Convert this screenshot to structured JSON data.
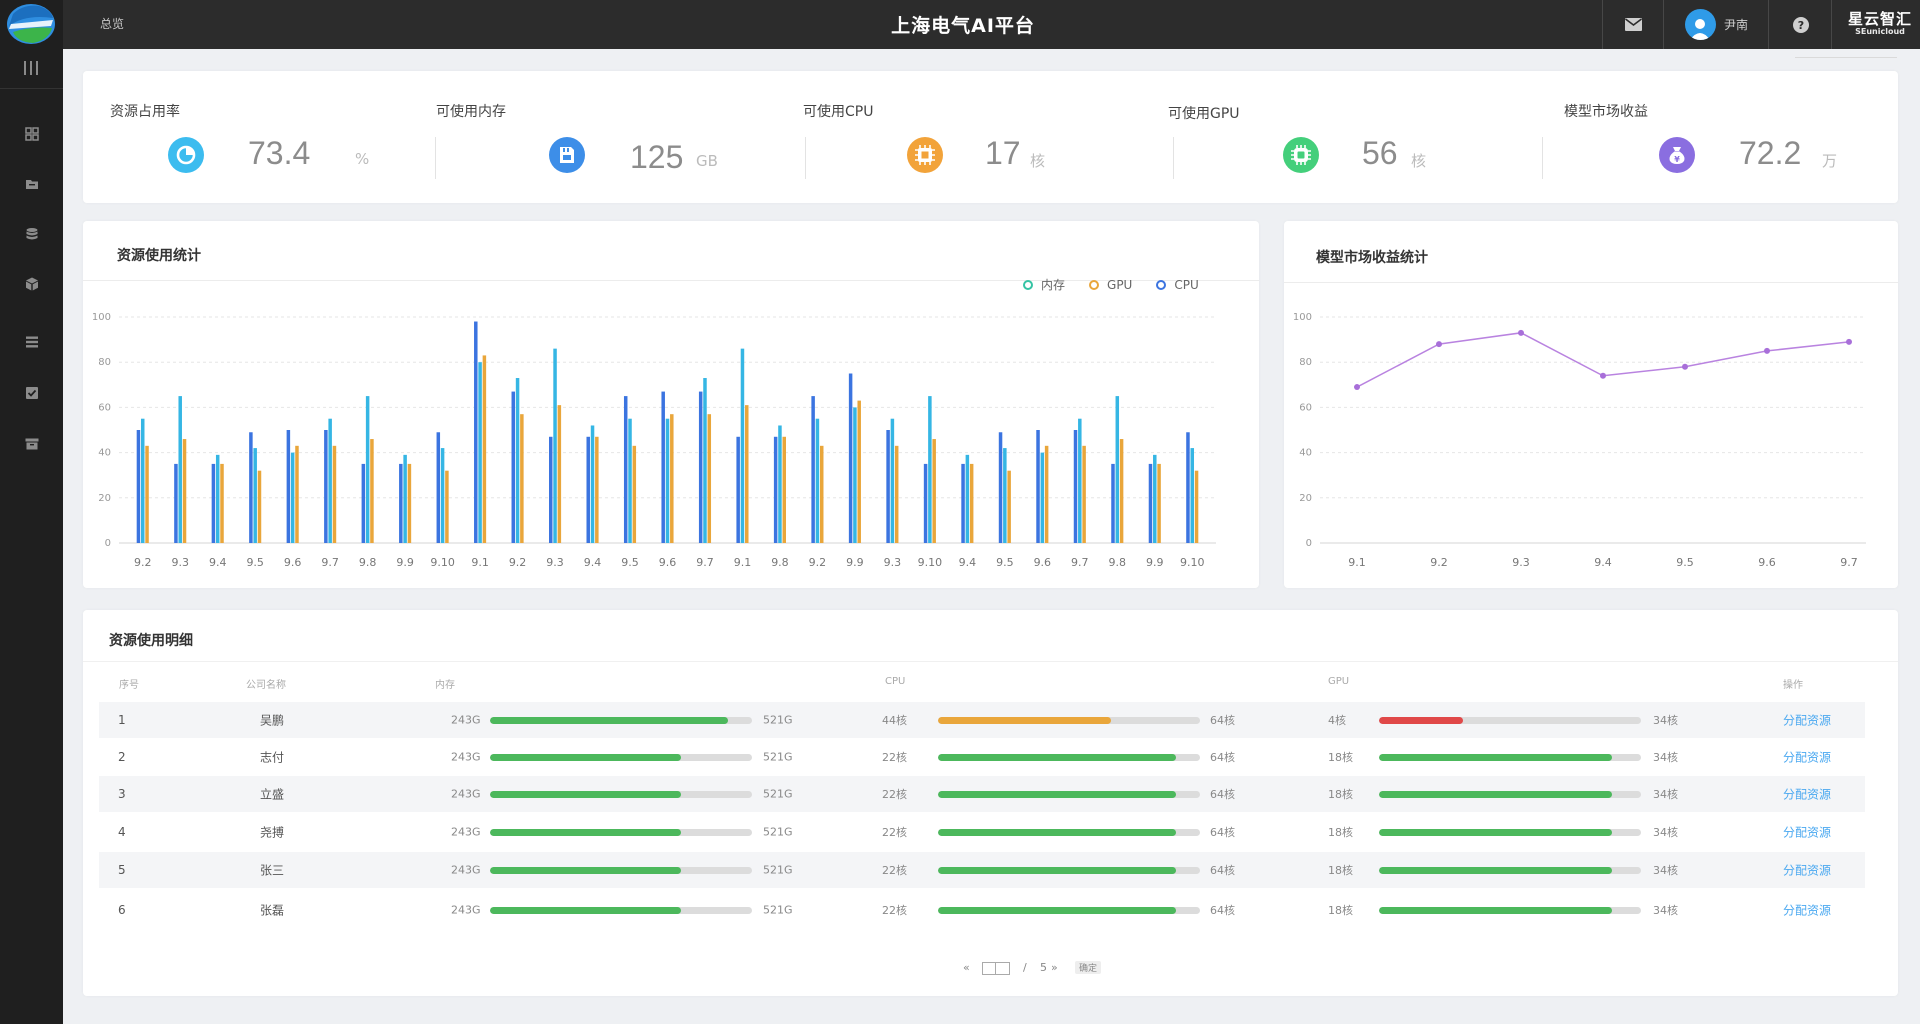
{
  "header": {
    "breadcrumb": "总览",
    "title": "上海电气AI平台",
    "user_name": "尹南",
    "brand_main": "星云智汇",
    "brand_sub": "SEunicloud"
  },
  "sidebar": {
    "items": [
      {
        "icon": "dashboard-icon"
      },
      {
        "icon": "folder-icon"
      },
      {
        "icon": "database-icon"
      },
      {
        "icon": "cube-icon"
      },
      {
        "icon": "list-icon"
      },
      {
        "icon": "checkbox-icon"
      },
      {
        "icon": "archive-icon"
      }
    ]
  },
  "stats": [
    {
      "label": "资源占用率",
      "value": "73.4",
      "unit": "%",
      "color": "#3cbcef",
      "icon": "gauge-icon"
    },
    {
      "label": "可使用内存",
      "value": "125",
      "unit": "GB",
      "color": "#3d8ee8",
      "icon": "memory-card-icon"
    },
    {
      "label": "可使用CPU",
      "value": "17",
      "unit": "核",
      "color": "#f2a33a",
      "icon": "cpu-chip-icon"
    },
    {
      "label": "可使用GPU",
      "value": "56",
      "unit": "核",
      "color": "#44cf7b",
      "icon": "gpu-chip-icon"
    },
    {
      "label": "模型市场收益",
      "value": "72.2",
      "unit": "万",
      "color": "#8a6ee0",
      "icon": "money-bag-icon"
    }
  ],
  "resource_chart": {
    "title": "资源使用统计",
    "legend": [
      {
        "name": "内存",
        "color": "#35c3a4"
      },
      {
        "name": "GPU",
        "color": "#e9a63b"
      },
      {
        "name": "CPU",
        "color": "#3b74e0"
      }
    ]
  },
  "revenue_chart": {
    "title": "模型市场收益统计"
  },
  "chart_data": [
    {
      "type": "bar",
      "title": "资源使用统计",
      "xlabel": "",
      "ylabel": "",
      "ylim": [
        0,
        100
      ],
      "yticks": [
        0,
        20,
        40,
        60,
        80,
        100
      ],
      "grid": true,
      "legend_position": "top-right",
      "categories": [
        "9.2",
        "9.3",
        "9.4",
        "9.5",
        "9.6",
        "9.7",
        "9.8",
        "9.9",
        "9.10",
        "9.1",
        "9.2",
        "9.3",
        "9.4",
        "9.5",
        "9.6",
        "9.7",
        "9.1",
        "9.8",
        "9.2",
        "9.9",
        "9.3",
        "9.10",
        "9.4",
        "9.5",
        "9.6",
        "9.7",
        "9.8",
        "9.9",
        "9.10"
      ],
      "series": [
        {
          "name": "CPU",
          "color": "#3b74e0",
          "values": [
            50,
            35,
            35,
            49,
            50,
            50,
            35,
            35,
            49,
            98,
            67,
            47,
            47,
            65,
            67,
            67,
            47,
            47,
            65,
            75,
            50,
            35,
            35,
            49,
            50,
            50,
            35,
            35,
            49
          ]
        },
        {
          "name": "内存",
          "color": "#35b6e4",
          "values": [
            55,
            65,
            39,
            42,
            40,
            55,
            65,
            39,
            42,
            80,
            73,
            86,
            52,
            55,
            55,
            73,
            86,
            52,
            55,
            60,
            55,
            65,
            39,
            42,
            40,
            55,
            65,
            39,
            42
          ]
        },
        {
          "name": "GPU",
          "color": "#e9a63b",
          "values": [
            43,
            46,
            35,
            32,
            43,
            43,
            46,
            35,
            32,
            83,
            57,
            61,
            47,
            43,
            57,
            57,
            61,
            47,
            43,
            63,
            43,
            46,
            35,
            32,
            43,
            43,
            46,
            35,
            32
          ]
        }
      ]
    },
    {
      "type": "line",
      "title": "模型市场收益统计",
      "xlabel": "",
      "ylabel": "",
      "ylim": [
        0,
        100
      ],
      "yticks": [
        0,
        20,
        40,
        60,
        80,
        100
      ],
      "grid": true,
      "x": [
        "9.1",
        "9.2",
        "9.3",
        "9.4",
        "9.5",
        "9.6",
        "9.7"
      ],
      "series": [
        {
          "color": "#b983e0",
          "values": [
            69,
            88,
            93,
            74,
            78,
            85,
            89
          ]
        }
      ]
    }
  ],
  "table": {
    "title": "资源使用明细",
    "columns": {
      "index": "序号",
      "company": "公司名称",
      "memory": "内存",
      "cpu": "CPU",
      "gpu": "GPU",
      "action": "操作"
    },
    "rows": [
      {
        "index": "1",
        "name": "吴鹏",
        "mem_used": "243G",
        "mem_total": "521G",
        "mem_ratio": 0.91,
        "cpu_used": "44核",
        "cpu_total": "64核",
        "cpu_ratio": 0.66,
        "cpu_color": "#e9a63b",
        "gpu_used": "4核",
        "gpu_total": "34核",
        "gpu_ratio": 0.32,
        "gpu_color": "#e04848",
        "action": "分配资源"
      },
      {
        "index": "2",
        "name": "志付",
        "mem_used": "243G",
        "mem_total": "521G",
        "mem_ratio": 0.73,
        "cpu_used": "22核",
        "cpu_total": "64核",
        "cpu_ratio": 0.91,
        "cpu_color": "#4cb85c",
        "gpu_used": "18核",
        "gpu_total": "34核",
        "gpu_ratio": 0.89,
        "gpu_color": "#4cb85c",
        "action": "分配资源"
      },
      {
        "index": "3",
        "name": "立盛",
        "mem_used": "243G",
        "mem_total": "521G",
        "mem_ratio": 0.73,
        "cpu_used": "22核",
        "cpu_total": "64核",
        "cpu_ratio": 0.91,
        "cpu_color": "#4cb85c",
        "gpu_used": "18核",
        "gpu_total": "34核",
        "gpu_ratio": 0.89,
        "gpu_color": "#4cb85c",
        "action": "分配资源"
      },
      {
        "index": "4",
        "name": "尧搏",
        "mem_used": "243G",
        "mem_total": "521G",
        "mem_ratio": 0.73,
        "cpu_used": "22核",
        "cpu_total": "64核",
        "cpu_ratio": 0.91,
        "cpu_color": "#4cb85c",
        "gpu_used": "18核",
        "gpu_total": "34核",
        "gpu_ratio": 0.89,
        "gpu_color": "#4cb85c",
        "action": "分配资源"
      },
      {
        "index": "5",
        "name": "张三",
        "mem_used": "243G",
        "mem_total": "521G",
        "mem_ratio": 0.73,
        "cpu_used": "22核",
        "cpu_total": "64核",
        "cpu_ratio": 0.91,
        "cpu_color": "#4cb85c",
        "gpu_used": "18核",
        "gpu_total": "34核",
        "gpu_ratio": 0.89,
        "gpu_color": "#4cb85c",
        "action": "分配资源"
      },
      {
        "index": "6",
        "name": "张磊",
        "mem_used": "243G",
        "mem_total": "521G",
        "mem_ratio": 0.73,
        "cpu_used": "22核",
        "cpu_total": "64核",
        "cpu_ratio": 0.91,
        "cpu_color": "#4cb85c",
        "gpu_used": "18核",
        "gpu_total": "34核",
        "gpu_ratio": 0.89,
        "gpu_color": "#4cb85c",
        "action": "分配资源"
      }
    ]
  },
  "pagination": {
    "prev": "«",
    "separator": "/",
    "total_pages": "5",
    "next": "»",
    "confirm": "确定"
  },
  "colors": {
    "memory_bar": "#4cb85c",
    "track": "#dcdcdc",
    "link": "#4aa8f0"
  }
}
